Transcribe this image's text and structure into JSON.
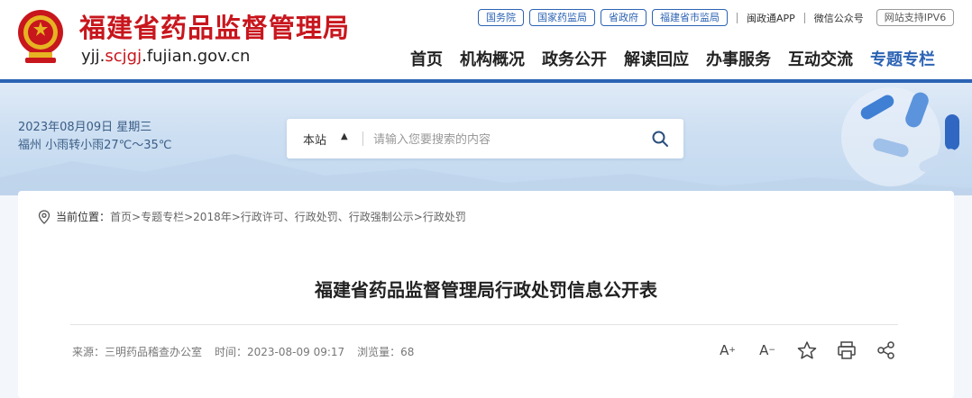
{
  "header": {
    "title": "福建省药品监督管理局",
    "domain_prefix": "yjj.",
    "domain_highlight": "scjgj",
    "domain_suffix": ".fujian.gov.cn",
    "top_links": [
      "国务院",
      "国家药监局",
      "省政府",
      "福建省市监局"
    ],
    "app_link": "闽政通APP",
    "wechat_link": "微信公众号",
    "ipv6_badge": "网站支持IPV6",
    "nav": [
      "首页",
      "机构概况",
      "政务公开",
      "解读回应",
      "办事服务",
      "互动交流",
      "专题专栏"
    ],
    "accent_color": "#2c63b4",
    "brand_color": "#c8161d"
  },
  "banner": {
    "date": "2023年08月09日 星期三",
    "weather": "福州 小雨转小雨27℃～35℃",
    "search": {
      "scope": "本站",
      "placeholder": "请输入您要搜索的内容"
    }
  },
  "breadcrumb": {
    "lead": "当前位置：",
    "items": [
      "首页",
      "专题专栏",
      "2018年",
      "行政许可、行政处罚、行政强制公示",
      "行政处罚"
    ],
    "separator": ">"
  },
  "article": {
    "title": "福建省药品监督管理局行政处罚信息公开表",
    "source": "来源：三明药品稽查办公室",
    "time": "时间：2023-08-09 09:17",
    "views": "浏览量：68"
  },
  "tools": {
    "font_up": "A",
    "font_down": "A",
    "font_up_mark": "+",
    "font_down_mark": "−"
  }
}
